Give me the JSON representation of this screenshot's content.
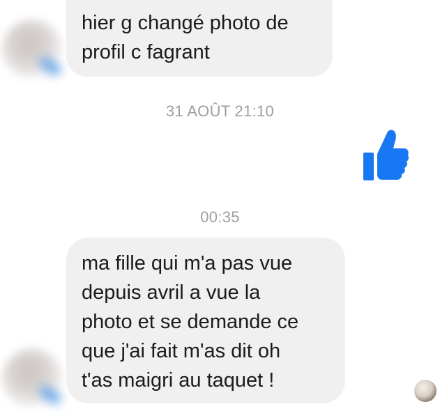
{
  "messages": [
    {
      "sender": "contact",
      "text": "hier g changé photo de\nprofil c fagrant"
    },
    {
      "sender": "contact",
      "text": "ma fille qui m'a pas vue\ndepuis avril a vue la\nphoto et se demande ce\nque j'ai fait m'as dit oh\nt'as maigri au taquet !"
    }
  ],
  "timestamps": [
    "31 AOÛT 21:10",
    "00:35"
  ],
  "reaction": {
    "icon": "thumbs-up-icon",
    "color": "#1877f2"
  },
  "colors": {
    "incoming_bubble": "#f1f0f0",
    "timestamp_text": "#9c9ea3"
  }
}
